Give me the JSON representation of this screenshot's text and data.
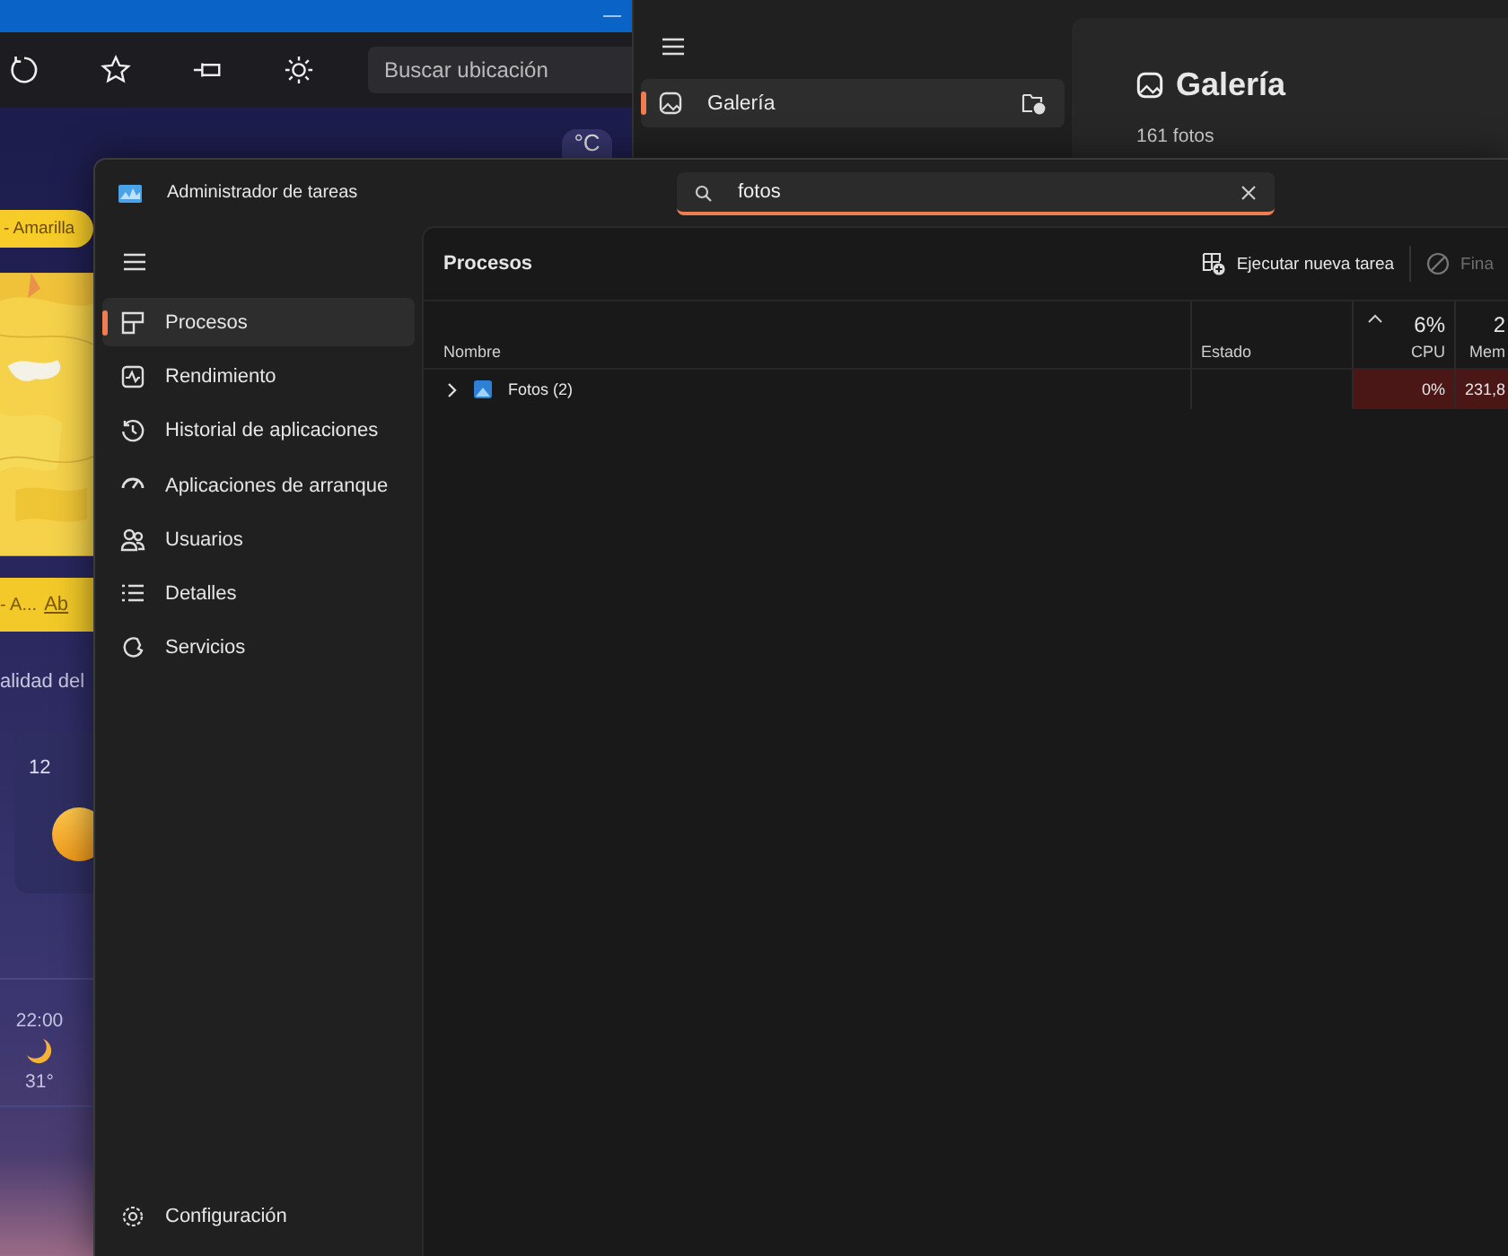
{
  "weather_window": {
    "search": {
      "placeholder": "Buscar ubicación"
    },
    "unit_button": "°C",
    "alert_pill": "- Amarilla",
    "alert_bar": {
      "text": "- A...",
      "link": "Ab"
    },
    "air_quality_text": "alidad del",
    "forecast_card": {
      "day": "12"
    },
    "hourly": [
      {
        "time": "22:00",
        "temp": "31°"
      }
    ]
  },
  "photos_window": {
    "nav": [
      {
        "label": "Galería",
        "selected": true
      }
    ],
    "title": "Galería",
    "count": "161 fotos"
  },
  "task_manager": {
    "title": "Administrador de tareas",
    "search": {
      "value": "fotos"
    },
    "nav": [
      {
        "label": "Procesos",
        "selected": true
      },
      {
        "label": "Rendimiento",
        "selected": false
      },
      {
        "label": "Historial de aplicaciones",
        "selected": false
      },
      {
        "label": "Aplicaciones de arranque",
        "selected": false
      },
      {
        "label": "Usuarios",
        "selected": false
      },
      {
        "label": "Detalles",
        "selected": false
      },
      {
        "label": "Servicios",
        "selected": false
      }
    ],
    "settings": "Configuración",
    "page_title": "Procesos",
    "actions": [
      {
        "label": "Ejecutar nueva tarea",
        "disabled": false
      },
      {
        "label": "Fina",
        "disabled": true
      }
    ],
    "columns": [
      {
        "label": "Nombre",
        "sorted": false
      },
      {
        "label": "Estado",
        "sorted": false
      },
      {
        "usage": "6%",
        "label": "CPU",
        "sorted": true
      },
      {
        "usage": "2",
        "label": "Mem",
        "sorted": false
      }
    ],
    "rows": [
      {
        "name": "Fotos (2)",
        "expanded": false,
        "cpu": "0%",
        "column_4": "231,8"
      }
    ]
  }
}
